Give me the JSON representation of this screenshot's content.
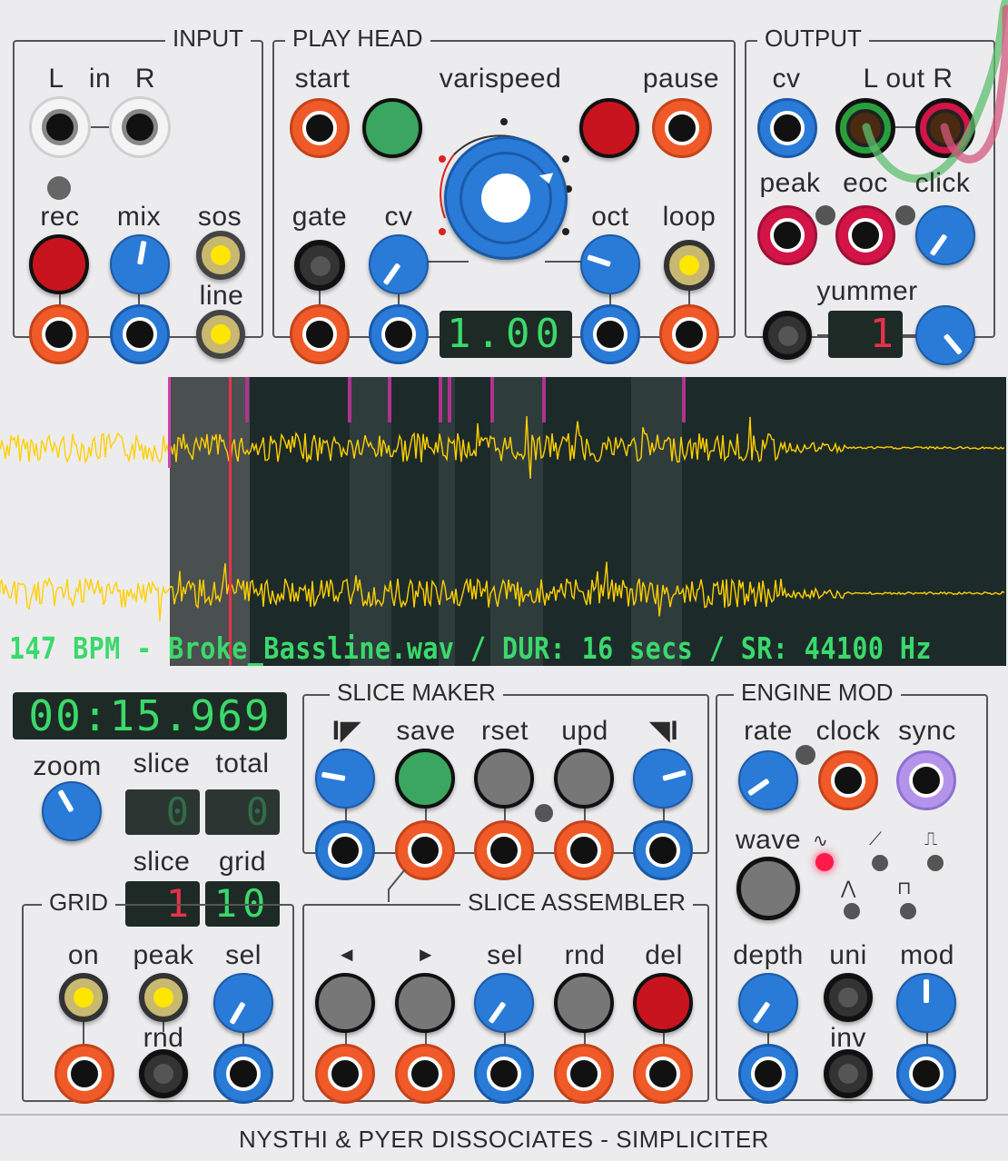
{
  "module": {
    "name": "NYSTHI & PYER DISSOCIATES - SIMPLICITER"
  },
  "colors": {
    "panel": "#ececee",
    "jack_orange": "#f05a28",
    "jack_blue": "#2a7bd8",
    "led_yellow": "#ffe600",
    "waveform": "#ffd000",
    "lcd_green": "#3ad96b",
    "lcd_red": "#e8324a"
  },
  "input": {
    "title": "INPUT",
    "l": "L",
    "in": "in",
    "r": "R",
    "rec": "rec",
    "mix": "mix",
    "sos": "sos",
    "line": "line"
  },
  "playhead": {
    "title": "PLAY HEAD",
    "start": "start",
    "varispeed": "varispeed",
    "pause": "pause",
    "gate": "gate",
    "cv": "cv",
    "oct": "oct",
    "loop": "loop",
    "speed_display": "1.00"
  },
  "output": {
    "title": "OUTPUT",
    "cv": "cv",
    "lout": "L out R",
    "peak": "peak",
    "eoc": "eoc",
    "click": "click",
    "yummer": "yummer",
    "yummer_display": "1"
  },
  "waveform": {
    "info": "147 BPM - Broke_Bassline.wav / DUR: 16 secs / SR: 44100 Hz"
  },
  "left": {
    "time": "00:15.969",
    "zoom": "zoom",
    "slice": "slice",
    "total": "total",
    "slice_value": "0",
    "total_value": "0",
    "slice2": "slice",
    "grid": "grid",
    "slice2_value": "1",
    "grid_value": "10"
  },
  "slice_maker": {
    "title": "SLICE MAKER",
    "start_icon": "I◤",
    "save": "save",
    "rset": "rset",
    "upd": "upd",
    "end_icon": "◥I"
  },
  "engine_mod": {
    "title": "ENGINE MOD",
    "rate": "rate",
    "clock": "clock",
    "sync": "sync",
    "wave": "wave",
    "depth": "depth",
    "uni": "uni",
    "mod": "mod",
    "inv": "inv"
  },
  "grid_sec": {
    "title": "GRID",
    "on": "on",
    "peak": "peak",
    "sel": "sel",
    "rnd": "rnd"
  },
  "slice_assembler": {
    "title": "SLICE ASSEMBLER",
    "prev": "◄",
    "next": "►",
    "sel": "sel",
    "rnd": "rnd",
    "del": "del"
  }
}
